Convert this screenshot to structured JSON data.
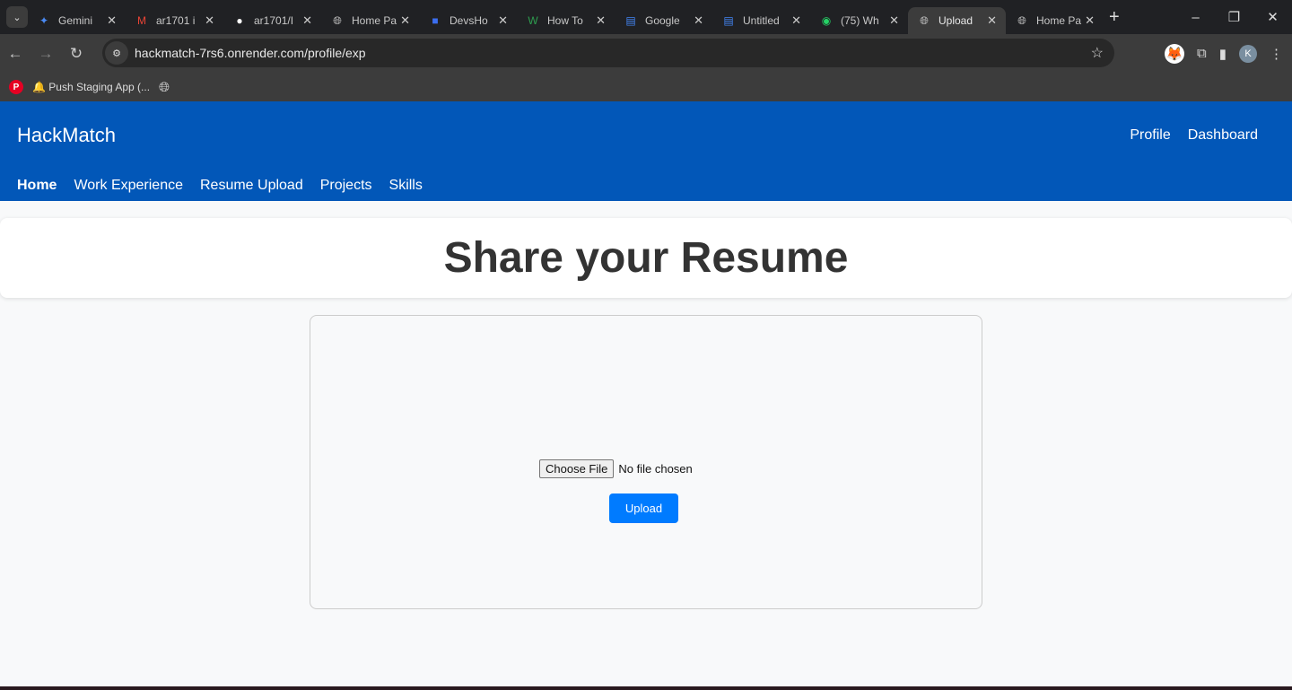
{
  "browser": {
    "tabs": [
      {
        "title": "Gemini",
        "icon": "gemini-icon",
        "color": "#4a8af4"
      },
      {
        "title": "ar1701 i",
        "icon": "gmail-icon",
        "color": "#ea4335"
      },
      {
        "title": "ar1701/I",
        "icon": "github-icon",
        "color": "#ffffff"
      },
      {
        "title": "Home Pa",
        "icon": "globe-icon",
        "color": "#cccccc"
      },
      {
        "title": "DevsHo",
        "icon": "devshouse-icon",
        "color": "#3b6ef0"
      },
      {
        "title": "How To",
        "icon": "wikihow-icon",
        "color": "#2e9e4f"
      },
      {
        "title": "Google",
        "icon": "google-docs-icon",
        "color": "#4285f4"
      },
      {
        "title": "Untitled",
        "icon": "google-docs-icon",
        "color": "#4285f4"
      },
      {
        "title": "(75) Wh",
        "icon": "whatsapp-icon",
        "color": "#25d366"
      },
      {
        "title": "Upload",
        "icon": "globe-icon",
        "color": "#cccccc",
        "active": true
      },
      {
        "title": "Home Pa",
        "icon": "globe-icon",
        "color": "#cccccc"
      }
    ],
    "url": "hackmatch-7rs6.onrender.com/profile/exp",
    "profile_initial": "K",
    "bookmarks": [
      {
        "label": "Push Staging App (..."
      }
    ]
  },
  "header": {
    "brand": "HackMatch",
    "right_nav": [
      "Profile",
      "Dashboard"
    ],
    "left_nav": [
      "Home",
      "Work Experience",
      "Resume Upload",
      "Projects",
      "Skills"
    ],
    "active": "Home",
    "color": "#0257b8"
  },
  "main": {
    "title": "Share your Resume",
    "choose_file": "Choose File",
    "file_status": "No file chosen",
    "upload": "Upload",
    "upload_color": "#007bff"
  }
}
